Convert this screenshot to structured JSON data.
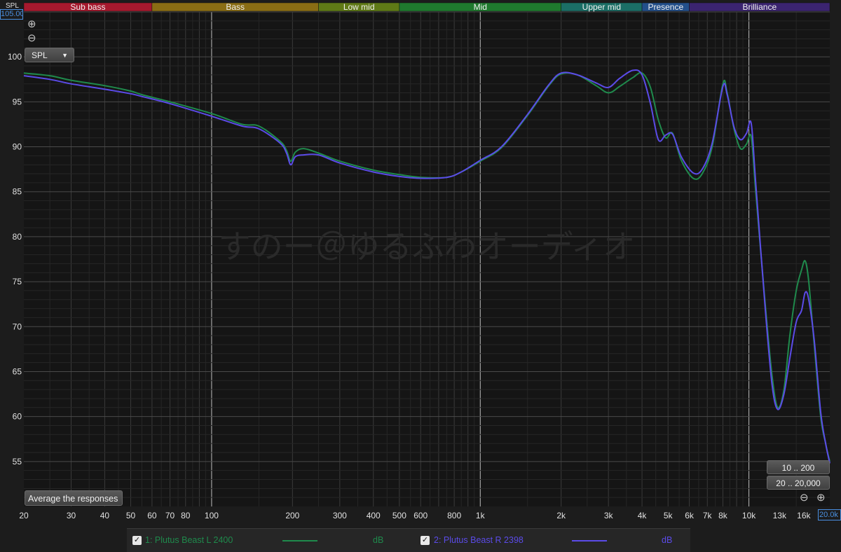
{
  "app": {
    "y_unit_label": "SPL",
    "y_max_value": "105.00",
    "x_max_value": "20.0k",
    "spl_dropdown": "SPL",
    "average_button": "Average the responses",
    "range_buttons": [
      "10 .. 200",
      "20 .. 20,000"
    ],
    "zoom_in_icon": "zoom-in-icon",
    "zoom_out_icon": "zoom-out-icon",
    "watermark": "すのー＠ゆるふわオーディオ"
  },
  "legend": [
    {
      "checked": true,
      "label": "1: Plutus Beast L 2400",
      "unit": "dB",
      "color": "#1f8a4c"
    },
    {
      "checked": true,
      "label": "2: Plutus Beast R 2398",
      "unit": "dB",
      "color": "#5b4be8"
    }
  ],
  "chart_data": {
    "type": "line",
    "xscale": "log",
    "xlim": [
      20,
      20000
    ],
    "ylim": [
      50,
      105
    ],
    "ylabel": "SPL",
    "grid": true,
    "bands": [
      {
        "name": "Sub bass",
        "from": 20,
        "to": 60,
        "color": "#a6192e"
      },
      {
        "name": "Bass",
        "from": 60,
        "to": 250,
        "color": "#8a6d14"
      },
      {
        "name": "Low mid",
        "from": 250,
        "to": 500,
        "color": "#5f7a16"
      },
      {
        "name": "Mid",
        "from": 500,
        "to": 2000,
        "color": "#1f7a2e"
      },
      {
        "name": "Upper mid",
        "from": 2000,
        "to": 4000,
        "color": "#1b6e66"
      },
      {
        "name": "Presence",
        "from": 4000,
        "to": 6000,
        "color": "#234f8a"
      },
      {
        "name": "Brilliance",
        "from": 6000,
        "to": 20000,
        "color": "#3b2470"
      }
    ],
    "x_ticks": [
      {
        "v": 20,
        "label": "20"
      },
      {
        "v": 30,
        "label": "30"
      },
      {
        "v": 40,
        "label": "40"
      },
      {
        "v": 50,
        "label": "50"
      },
      {
        "v": 60,
        "label": "60"
      },
      {
        "v": 70,
        "label": "70"
      },
      {
        "v": 80,
        "label": "80"
      },
      {
        "v": 100,
        "label": "100"
      },
      {
        "v": 200,
        "label": "200"
      },
      {
        "v": 300,
        "label": "300"
      },
      {
        "v": 400,
        "label": "400"
      },
      {
        "v": 500,
        "label": "500"
      },
      {
        "v": 600,
        "label": "600"
      },
      {
        "v": 800,
        "label": "800"
      },
      {
        "v": 1000,
        "label": "1k"
      },
      {
        "v": 2000,
        "label": "2k"
      },
      {
        "v": 3000,
        "label": "3k"
      },
      {
        "v": 4000,
        "label": "4k"
      },
      {
        "v": 5000,
        "label": "5k"
      },
      {
        "v": 6000,
        "label": "6k"
      },
      {
        "v": 7000,
        "label": "7k"
      },
      {
        "v": 8000,
        "label": "8k"
      },
      {
        "v": 10000,
        "label": "10k"
      },
      {
        "v": 13000,
        "label": "13k"
      },
      {
        "v": 16000,
        "label": "16k"
      }
    ],
    "y_ticks": [
      55,
      60,
      65,
      70,
      75,
      80,
      85,
      90,
      95,
      100
    ],
    "series": [
      {
        "name": "1: Plutus Beast L 2400",
        "color": "#1f8a4c",
        "points": [
          [
            20,
            98.2
          ],
          [
            25,
            97.9
          ],
          [
            30,
            97.4
          ],
          [
            40,
            96.8
          ],
          [
            50,
            96.2
          ],
          [
            55,
            95.8
          ],
          [
            70,
            95.0
          ],
          [
            100,
            93.7
          ],
          [
            130,
            92.5
          ],
          [
            150,
            92.3
          ],
          [
            180,
            90.6
          ],
          [
            190,
            89.6
          ],
          [
            197,
            88.4
          ],
          [
            205,
            89.4
          ],
          [
            220,
            89.8
          ],
          [
            250,
            89.3
          ],
          [
            300,
            88.4
          ],
          [
            400,
            87.4
          ],
          [
            500,
            86.9
          ],
          [
            600,
            86.6
          ],
          [
            750,
            86.6
          ],
          [
            850,
            87.2
          ],
          [
            1000,
            88.4
          ],
          [
            1200,
            89.9
          ],
          [
            1500,
            93.5
          ],
          [
            1800,
            96.8
          ],
          [
            2000,
            98.1
          ],
          [
            2300,
            98.0
          ],
          [
            2700,
            96.8
          ],
          [
            3000,
            96.0
          ],
          [
            3300,
            96.7
          ],
          [
            3700,
            97.7
          ],
          [
            4000,
            98.2
          ],
          [
            4300,
            96.6
          ],
          [
            4600,
            93.0
          ],
          [
            4900,
            91.0
          ],
          [
            5200,
            91.5
          ],
          [
            5600,
            88.5
          ],
          [
            6200,
            86.5
          ],
          [
            6700,
            87.0
          ],
          [
            7300,
            90.0
          ],
          [
            8000,
            97.0
          ],
          [
            8300,
            96.0
          ],
          [
            8800,
            92.0
          ],
          [
            9300,
            89.8
          ],
          [
            9800,
            90.3
          ],
          [
            10200,
            91.1
          ],
          [
            10600,
            85.0
          ],
          [
            11500,
            72.5
          ],
          [
            12200,
            64.5
          ],
          [
            12800,
            61.0
          ],
          [
            13500,
            63.0
          ],
          [
            14200,
            69.0
          ],
          [
            15000,
            74.0
          ],
          [
            15700,
            76.3
          ],
          [
            16200,
            77.3
          ],
          [
            16700,
            75.0
          ],
          [
            17500,
            68.0
          ],
          [
            18500,
            60.0
          ],
          [
            19300,
            57.0
          ],
          [
            20000,
            55.0
          ]
        ]
      },
      {
        "name": "2: Plutus Beast R 2398",
        "color": "#5b4be8",
        "points": [
          [
            20,
            97.9
          ],
          [
            25,
            97.5
          ],
          [
            30,
            97.0
          ],
          [
            40,
            96.4
          ],
          [
            50,
            95.9
          ],
          [
            55,
            95.6
          ],
          [
            70,
            94.8
          ],
          [
            100,
            93.4
          ],
          [
            130,
            92.3
          ],
          [
            150,
            92.0
          ],
          [
            180,
            90.4
          ],
          [
            190,
            89.3
          ],
          [
            197,
            88.0
          ],
          [
            205,
            88.9
          ],
          [
            220,
            89.1
          ],
          [
            250,
            89.1
          ],
          [
            300,
            88.2
          ],
          [
            400,
            87.2
          ],
          [
            500,
            86.7
          ],
          [
            600,
            86.5
          ],
          [
            750,
            86.6
          ],
          [
            850,
            87.2
          ],
          [
            1000,
            88.5
          ],
          [
            1200,
            90.0
          ],
          [
            1500,
            93.6
          ],
          [
            1800,
            96.9
          ],
          [
            2000,
            98.2
          ],
          [
            2300,
            98.0
          ],
          [
            2700,
            97.1
          ],
          [
            3000,
            96.6
          ],
          [
            3300,
            97.6
          ],
          [
            3700,
            98.5
          ],
          [
            4000,
            98.0
          ],
          [
            4300,
            94.8
          ],
          [
            4600,
            90.8
          ],
          [
            4900,
            91.3
          ],
          [
            5200,
            91.4
          ],
          [
            5600,
            88.9
          ],
          [
            6200,
            87.1
          ],
          [
            6700,
            87.5
          ],
          [
            7300,
            90.4
          ],
          [
            8000,
            96.7
          ],
          [
            8300,
            95.8
          ],
          [
            8800,
            92.2
          ],
          [
            9300,
            90.8
          ],
          [
            9800,
            91.5
          ],
          [
            10200,
            92.6
          ],
          [
            10600,
            86.0
          ],
          [
            11500,
            72.0
          ],
          [
            12200,
            63.5
          ],
          [
            12800,
            60.8
          ],
          [
            13500,
            62.5
          ],
          [
            14200,
            66.5
          ],
          [
            15000,
            70.5
          ],
          [
            15700,
            71.8
          ],
          [
            16200,
            73.8
          ],
          [
            16700,
            73.0
          ],
          [
            17500,
            68.5
          ],
          [
            18500,
            60.5
          ],
          [
            19300,
            57.0
          ],
          [
            20000,
            54.8
          ]
        ]
      }
    ]
  }
}
